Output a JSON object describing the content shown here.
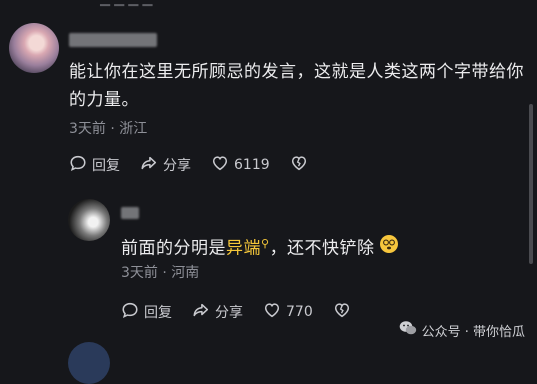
{
  "comment1": {
    "text_line1": "能让你在这里无所顾忌的发言，这就是人类这两个字带给你",
    "text_line2": "的力量。",
    "meta": "3天前 · 浙江",
    "reply_label": "回复",
    "share_label": "分享",
    "like_count": "6119"
  },
  "comment2": {
    "text_before": "前面的分明是",
    "text_highlight": "异端",
    "text_after": "，还不快铲除",
    "meta": "3天前 · 河南",
    "reply_label": "回复",
    "share_label": "分享",
    "like_count": "770"
  },
  "watermark": {
    "text": "公众号 · 带你恰瓜"
  },
  "colors": {
    "background": "#16171b",
    "highlight": "#f5c73a",
    "meta": "#8e9098"
  }
}
